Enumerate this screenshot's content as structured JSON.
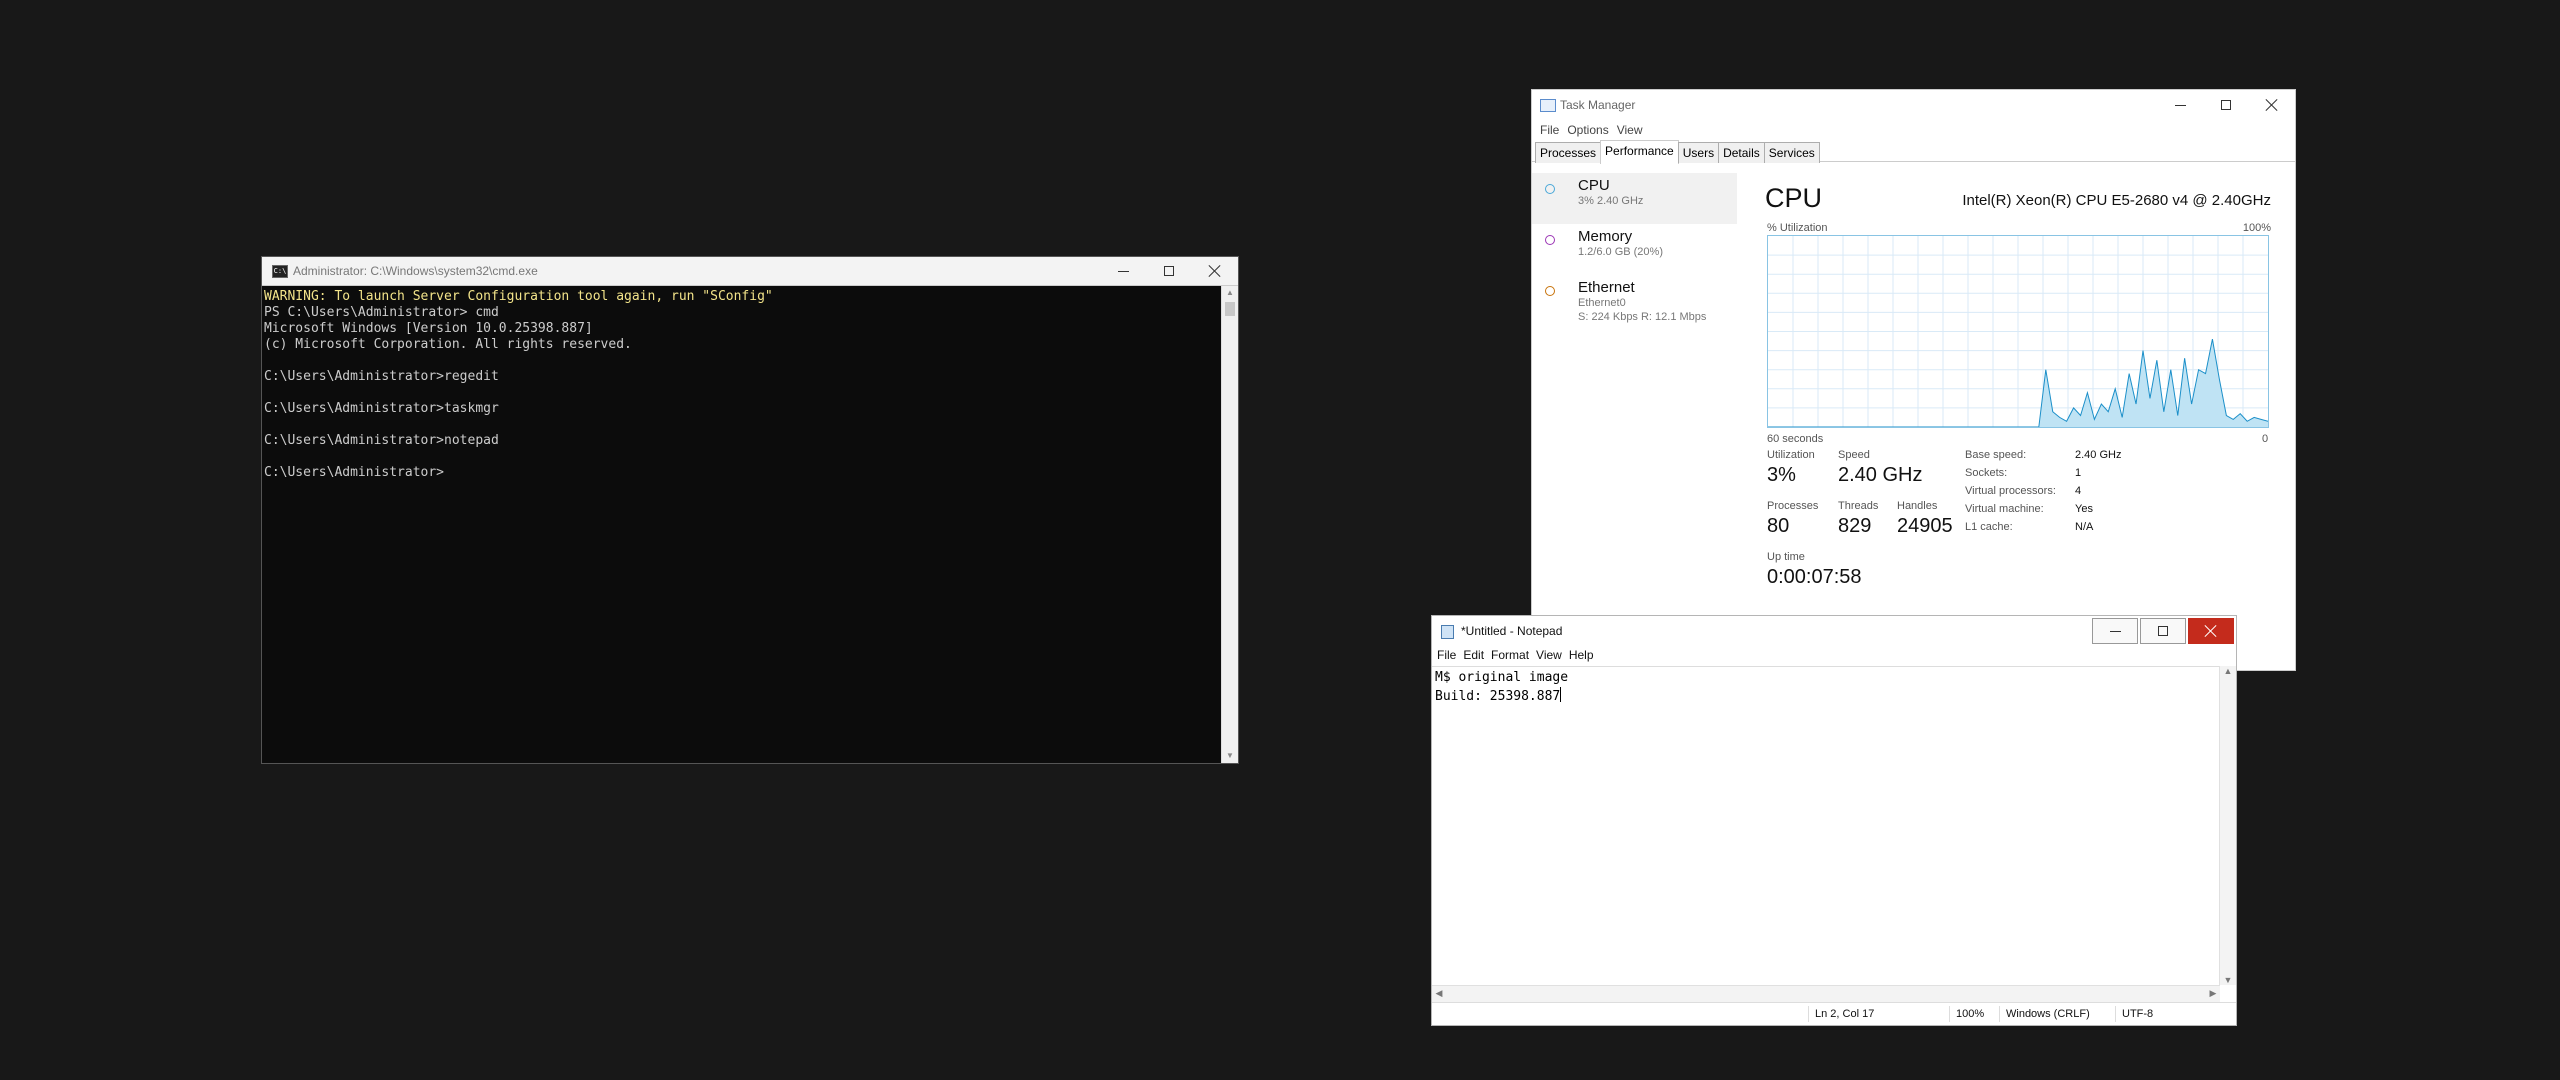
{
  "cmd": {
    "title": "Administrator: C:\\Windows\\system32\\cmd.exe",
    "icon": "cmd-icon",
    "lines": [
      {
        "text": "WARNING: To launch Server Configuration tool again, run \"SConfig\"",
        "warn": true
      },
      {
        "text": "PS C:\\Users\\Administrator> cmd"
      },
      {
        "text": "Microsoft Windows [Version 10.0.25398.887]"
      },
      {
        "text": "(c) Microsoft Corporation. All rights reserved."
      },
      {
        "text": ""
      },
      {
        "text": "C:\\Users\\Administrator>regedit"
      },
      {
        "text": ""
      },
      {
        "text": "C:\\Users\\Administrator>taskmgr"
      },
      {
        "text": ""
      },
      {
        "text": "C:\\Users\\Administrator>notepad"
      },
      {
        "text": ""
      },
      {
        "text": "C:\\Users\\Administrator>"
      }
    ]
  },
  "taskmgr": {
    "title": "Task Manager",
    "menu": [
      "File",
      "Options",
      "View"
    ],
    "tabs": [
      "Processes",
      "Performance",
      "Users",
      "Details",
      "Services"
    ],
    "active_tab": 1,
    "sidebar": [
      {
        "name": "CPU",
        "sub1": "3% 2.40 GHz",
        "sub2": "",
        "color": "#4aa8d8"
      },
      {
        "name": "Memory",
        "sub1": "1.2/6.0 GB (20%)",
        "sub2": "",
        "color": "#9c36b5"
      },
      {
        "name": "Ethernet",
        "sub1": "Ethernet0",
        "sub2": "S: 224 Kbps R: 12.1 Mbps",
        "color": "#c8730b"
      }
    ],
    "heading": "CPU",
    "cpu_model": "Intel(R) Xeon(R) CPU E5-2680 v4 @ 2.40GHz",
    "util_label": "% Utilization",
    "util_max": "100%",
    "axis_left": "60 seconds",
    "axis_right": "0",
    "stats": {
      "utilization_label": "Utilization",
      "utilization": "3%",
      "speed_label": "Speed",
      "speed": "2.40 GHz",
      "processes_label": "Processes",
      "processes": "80",
      "threads_label": "Threads",
      "threads": "829",
      "handles_label": "Handles",
      "handles": "24905",
      "uptime_label": "Up time",
      "uptime": "0:00:07:58"
    },
    "specs": [
      {
        "k": "Base speed:",
        "v": "2.40 GHz"
      },
      {
        "k": "Sockets:",
        "v": "1"
      },
      {
        "k": "Virtual processors:",
        "v": "4"
      },
      {
        "k": "Virtual machine:",
        "v": "Yes"
      },
      {
        "k": "L1 cache:",
        "v": "N/A"
      }
    ]
  },
  "chart_data": {
    "type": "area",
    "title": "",
    "xlabel": "",
    "ylabel": "% Utilization",
    "ylim": [
      0,
      100
    ],
    "xlim": [
      60,
      0
    ],
    "grid": true,
    "series": [
      {
        "values": [
          0,
          0,
          0,
          0,
          0,
          0,
          0,
          0,
          0,
          0,
          0,
          0,
          0,
          0,
          0,
          0,
          0,
          0,
          0,
          0,
          0,
          0,
          0,
          0,
          0,
          0,
          0,
          0,
          0,
          0,
          0,
          0,
          0,
          0,
          0,
          0,
          0,
          0,
          0,
          0,
          30,
          8,
          5,
          3,
          10,
          6,
          18,
          4,
          12,
          8,
          20,
          5,
          28,
          12,
          40,
          15,
          35,
          8,
          30,
          6,
          36,
          12,
          30,
          28,
          46,
          25,
          6,
          4,
          7,
          3,
          5,
          4,
          3
        ]
      }
    ]
  },
  "notepad": {
    "title": "*Untitled - Notepad",
    "menu": [
      "File",
      "Edit",
      "Format",
      "View",
      "Help"
    ],
    "line1": "M$ original image",
    "line2": "Build: 25398.887",
    "status": {
      "pos": "Ln 2, Col 17",
      "zoom": "100%",
      "eol": "Windows (CRLF)",
      "enc": "UTF-8"
    }
  }
}
